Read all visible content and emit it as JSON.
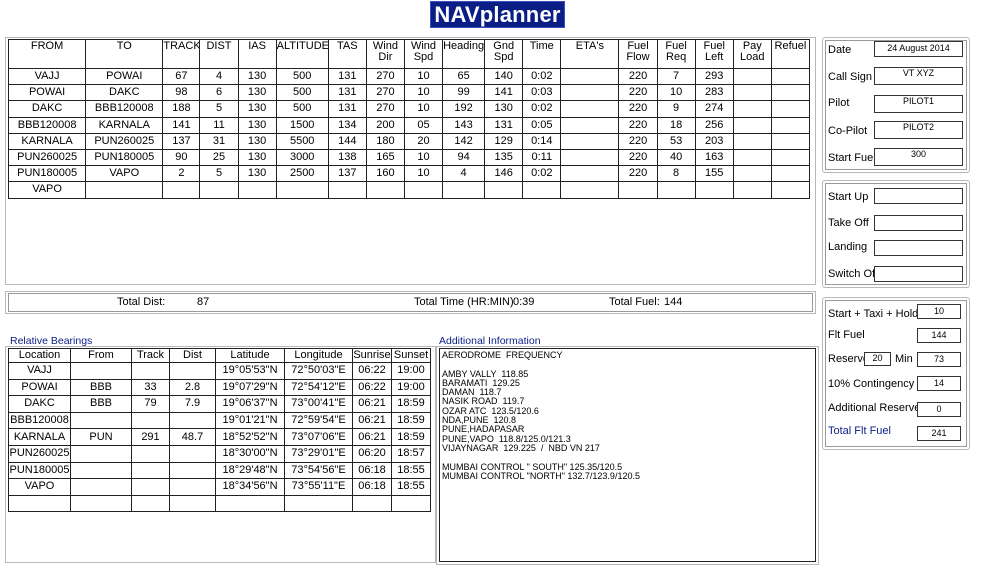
{
  "app": {
    "title": "NAVplanner"
  },
  "nav": {
    "headers": [
      [
        "FROM"
      ],
      [
        "TO"
      ],
      [
        "TRACK"
      ],
      [
        "DIST"
      ],
      [
        "IAS"
      ],
      [
        "ALTITUDE"
      ],
      [
        "TAS"
      ],
      [
        "Wind",
        "Dir"
      ],
      [
        "Wind",
        "Spd"
      ],
      [
        "Heading"
      ],
      [
        "Gnd",
        "Spd"
      ],
      [
        "Time"
      ],
      [
        "ETA's"
      ],
      [
        "Fuel",
        "Flow"
      ],
      [
        "Fuel",
        "Req"
      ],
      [
        "Fuel",
        "Left"
      ],
      [
        "Pay",
        "Load"
      ],
      [
        "Refuel"
      ]
    ],
    "rows": [
      [
        "VAJJ",
        "POWAI",
        "67",
        "4",
        "130",
        "500",
        "131",
        "270",
        "10",
        "65",
        "140",
        "0:02",
        "",
        "220",
        "7",
        "293",
        "",
        ""
      ],
      [
        "POWAI",
        "DAKC",
        "98",
        "6",
        "130",
        "500",
        "131",
        "270",
        "10",
        "99",
        "141",
        "0:03",
        "",
        "220",
        "10",
        "283",
        "",
        ""
      ],
      [
        "DAKC",
        "BBB120008",
        "188",
        "5",
        "130",
        "500",
        "131",
        "270",
        "10",
        "192",
        "130",
        "0:02",
        "",
        "220",
        "9",
        "274",
        "",
        ""
      ],
      [
        "BBB120008",
        "KARNALA",
        "141",
        "11",
        "130",
        "1500",
        "134",
        "200",
        "05",
        "143",
        "131",
        "0:05",
        "",
        "220",
        "18",
        "256",
        "",
        ""
      ],
      [
        "KARNALA",
        "PUN260025",
        "137",
        "31",
        "130",
        "5500",
        "144",
        "180",
        "20",
        "142",
        "129",
        "0:14",
        "",
        "220",
        "53",
        "203",
        "",
        ""
      ],
      [
        "PUN260025",
        "PUN180005",
        "90",
        "25",
        "130",
        "3000",
        "138",
        "165",
        "10",
        "94",
        "135",
        "0:11",
        "",
        "220",
        "40",
        "163",
        "",
        ""
      ],
      [
        "PUN180005",
        "VAPO",
        "2",
        "5",
        "130",
        "2500",
        "137",
        "160",
        "10",
        "4",
        "146",
        "0:02",
        "",
        "220",
        "8",
        "155",
        "",
        ""
      ],
      [
        "VAPO",
        "",
        "",
        "",
        "",
        "",
        "",
        "",
        "",
        "",
        "",
        "",
        "",
        "",
        "",
        "",
        "",
        ""
      ]
    ]
  },
  "totals": {
    "dist_label": "Total Dist:",
    "dist_value": "87",
    "time_label": "Total Time (HR:MIN)",
    "time_value": "0:39",
    "fuel_label": "Total Fuel:",
    "fuel_value": "144"
  },
  "relative_bearings": {
    "title": "Relative Bearings",
    "headers": [
      "Location",
      "From",
      "Track",
      "Dist",
      "Latitude",
      "Longitude",
      "Sunrise",
      "Sunset"
    ],
    "rows": [
      [
        "VAJJ",
        "",
        "",
        "",
        "19°05'53\"N",
        "72°50'03\"E",
        "06:22",
        "19:00"
      ],
      [
        "POWAI",
        "BBB",
        "33",
        "2.8",
        "19°07'29\"N",
        "72°54'12\"E",
        "06:22",
        "19:00"
      ],
      [
        "DAKC",
        "BBB",
        "79",
        "7.9",
        "19°06'37\"N",
        "73°00'41\"E",
        "06:21",
        "18:59"
      ],
      [
        "BBB120008",
        "",
        "",
        "",
        "19°01'21\"N",
        "72°59'54\"E",
        "06:21",
        "18:59"
      ],
      [
        "KARNALA",
        "PUN",
        "291",
        "48.7",
        "18°52'52\"N",
        "73°07'06\"E",
        "06:21",
        "18:59"
      ],
      [
        "PUN260025",
        "",
        "",
        "",
        "18°30'00\"N",
        "73°29'01\"E",
        "06:20",
        "18:57"
      ],
      [
        "PUN180005",
        "",
        "",
        "",
        "18°29'48\"N",
        "73°54'56\"E",
        "06:18",
        "18:55"
      ],
      [
        "VAPO",
        "",
        "",
        "",
        "18°34'56\"N",
        "73°55'11\"E",
        "06:18",
        "18:55"
      ],
      [
        "",
        "",
        "",
        "",
        "",
        "",
        "",
        ""
      ]
    ]
  },
  "additional_info": {
    "title": "Additional Information",
    "lines": [
      "AERODROME  FREQUENCY",
      "",
      "AMBY VALLY  118.85",
      "BARAMATI  129.25",
      "DAMAN  118.7",
      "NASIK ROAD  119.7",
      "OZAR ATC  123.5/120.6",
      "NDA,PUNE  120.8",
      "PUNE,HADAPASAR",
      "PUNE,VAPO  118.8/125.0/121.3",
      "VIJAYNAGAR  129.225  /  NBD VN 217",
      "",
      "MUMBAI CONTROL \" SOUTH\" 125.35/120.5",
      "MUMBAI CONTROL \"NORTH\" 132.7/123.9/120.5"
    ]
  },
  "flight": {
    "date_label": "Date",
    "date_value": "24 August 2014",
    "callsign_label": "Call Sign",
    "callsign_value": "VT XYZ",
    "pilot_label": "Pilot",
    "pilot_value": "PILOT1",
    "copilot_label": "Co-Pilot",
    "copilot_value": "PILOT2",
    "startfuel_label": "Start Fuel",
    "startfuel_value": "300"
  },
  "times": {
    "startup_label": "Start Up",
    "startup_value": "",
    "takeoff_label": "Take Off",
    "takeoff_value": "",
    "landing_label": "Landing",
    "landing_value": "",
    "switchoff_label": "Switch Off",
    "switchoff_value": ""
  },
  "fuel": {
    "taxi_label": "Start + Taxi + Hold",
    "taxi_value": "10",
    "flt_label": "Flt Fuel",
    "flt_value": "144",
    "reserve_label": "Reserve",
    "reserve_min_input": "20",
    "min_label": "Min",
    "reserve_value": "73",
    "contingency_label": "10% Contingency",
    "contingency_value": "14",
    "additional_label": "Additional Reserve",
    "additional_value": "0",
    "total_label": "Total Flt Fuel",
    "total_value": "241"
  },
  "colors": {
    "title_bg": "#0a1e86",
    "accent_text": "#0a1e86"
  }
}
